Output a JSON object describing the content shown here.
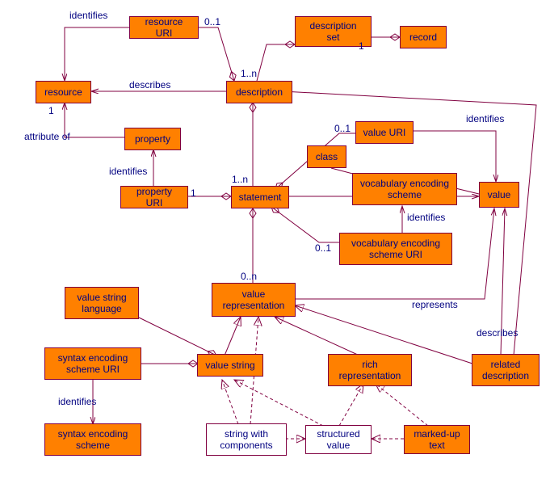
{
  "nodes": {
    "resource_uri": "resource URI",
    "description_set": "description set",
    "record": "record",
    "resource": "resource",
    "description": "description",
    "property": "property",
    "value_uri": "value URI",
    "property_uri": "property URI",
    "statement": "statement",
    "class": "class",
    "vocab_enc_scheme": "vocabulary encoding scheme",
    "value": "value",
    "vocab_enc_scheme_uri": "vocabulary encoding scheme URI",
    "value_string_lang": "value string language",
    "value_representation": "value representation",
    "syntax_enc_scheme_uri": "syntax encoding scheme URI",
    "value_string": "value string",
    "rich_representation": "rich representation",
    "related_description": "related description",
    "syntax_enc_scheme": "syntax encoding scheme",
    "string_with_components": "string with components",
    "structured_value": "structured value",
    "marked_up_text": "marked-up text"
  },
  "labels": {
    "identifies_1": "identifies",
    "c01_1": "0..1",
    "c1_recordset": "1",
    "describes": "describes",
    "c1n_desc": "1..n",
    "c1_resource": "1",
    "attribute_of": "attribute of",
    "identifies_prop": "identifies",
    "c1_propuri": "1",
    "c1n_stmt": "1..n",
    "c01_valueuri": "0..1",
    "identifies_value": "identifies",
    "identifies_ves": "identifies",
    "c01_ves": "0..1",
    "c0n_valrep": "0..n",
    "represents": "represents",
    "describes_rel": "describes",
    "identifies_ses": "identifies"
  },
  "chart_data": {
    "type": "diagram",
    "title": "DCMI Abstract Model (Description Set Model)",
    "entities": [
      {
        "id": "record",
        "name": "record",
        "kind": "class"
      },
      {
        "id": "description_set",
        "name": "description set",
        "kind": "class"
      },
      {
        "id": "description",
        "name": "description",
        "kind": "class"
      },
      {
        "id": "resource",
        "name": "resource",
        "kind": "class"
      },
      {
        "id": "resource_uri",
        "name": "resource URI",
        "kind": "class"
      },
      {
        "id": "property",
        "name": "property",
        "kind": "class"
      },
      {
        "id": "property_uri",
        "name": "property URI",
        "kind": "class"
      },
      {
        "id": "statement",
        "name": "statement",
        "kind": "class"
      },
      {
        "id": "class",
        "name": "class",
        "kind": "class"
      },
      {
        "id": "value",
        "name": "value",
        "kind": "class"
      },
      {
        "id": "value_uri",
        "name": "value URI",
        "kind": "class"
      },
      {
        "id": "vocab_enc_scheme",
        "name": "vocabulary encoding scheme",
        "kind": "class"
      },
      {
        "id": "vocab_enc_scheme_uri",
        "name": "vocabulary encoding scheme URI",
        "kind": "class"
      },
      {
        "id": "value_representation",
        "name": "value representation",
        "kind": "class"
      },
      {
        "id": "value_string",
        "name": "value string",
        "kind": "class"
      },
      {
        "id": "rich_representation",
        "name": "rich representation",
        "kind": "class"
      },
      {
        "id": "value_string_lang",
        "name": "value string language",
        "kind": "class"
      },
      {
        "id": "syntax_enc_scheme_uri",
        "name": "syntax encoding scheme URI",
        "kind": "class"
      },
      {
        "id": "syntax_enc_scheme",
        "name": "syntax encoding scheme",
        "kind": "class"
      },
      {
        "id": "related_description",
        "name": "related description",
        "kind": "class"
      },
      {
        "id": "string_with_components",
        "name": "string with components",
        "kind": "class-abstract"
      },
      {
        "id": "structured_value",
        "name": "structured value",
        "kind": "class-abstract"
      },
      {
        "id": "marked_up_text",
        "name": "marked-up text",
        "kind": "class"
      }
    ],
    "relationships": [
      {
        "from": "record",
        "to": "description_set",
        "type": "aggregation",
        "mult_to": "1"
      },
      {
        "from": "description_set",
        "to": "description",
        "type": "aggregation",
        "mult_to": "1..n"
      },
      {
        "from": "description",
        "to": "resource_uri",
        "type": "aggregation",
        "mult_to": "0..1"
      },
      {
        "from": "description",
        "to": "statement",
        "type": "aggregation",
        "mult_to": "1..n"
      },
      {
        "from": "description",
        "to": "resource",
        "type": "association",
        "label": "describes",
        "mult_to": "1"
      },
      {
        "from": "resource_uri",
        "to": "resource",
        "type": "association",
        "label": "identifies"
      },
      {
        "from": "property",
        "to": "resource",
        "type": "association",
        "label": "attribute of"
      },
      {
        "from": "property_uri",
        "to": "property",
        "type": "association",
        "label": "identifies"
      },
      {
        "from": "statement",
        "to": "property_uri",
        "type": "aggregation",
        "mult_to": "1"
      },
      {
        "from": "statement",
        "to": "value_uri",
        "type": "aggregation",
        "mult_to": "0..1"
      },
      {
        "from": "statement",
        "to": "vocab_enc_scheme_uri",
        "type": "aggregation",
        "mult_to": "0..1"
      },
      {
        "from": "statement",
        "to": "value_representation",
        "type": "aggregation",
        "mult_to": "0..n"
      },
      {
        "from": "statement",
        "to": "value",
        "type": "association"
      },
      {
        "from": "value_uri",
        "to": "value",
        "type": "association",
        "label": "identifies"
      },
      {
        "from": "vocab_enc_scheme_uri",
        "to": "vocab_enc_scheme",
        "type": "association",
        "label": "identifies"
      },
      {
        "from": "class",
        "to": "vocab_enc_scheme",
        "type": "association"
      },
      {
        "from": "vocab_enc_scheme",
        "to": "value",
        "type": "association"
      },
      {
        "from": "value_representation",
        "to": "value",
        "type": "association",
        "label": "represents"
      },
      {
        "from": "related_description",
        "to": "value",
        "type": "association",
        "label": "describes"
      },
      {
        "from": "value_string",
        "to": "value_representation",
        "type": "generalization"
      },
      {
        "from": "rich_representation",
        "to": "value_representation",
        "type": "generalization"
      },
      {
        "from": "related_description",
        "to": "value_representation",
        "type": "generalization"
      },
      {
        "from": "value_string",
        "to": "value_string_lang",
        "type": "aggregation"
      },
      {
        "from": "value_string",
        "to": "syntax_enc_scheme_uri",
        "type": "aggregation"
      },
      {
        "from": "syntax_enc_scheme_uri",
        "to": "syntax_enc_scheme",
        "type": "association",
        "label": "identifies"
      },
      {
        "from": "string_with_components",
        "to": "value_string",
        "type": "realization"
      },
      {
        "from": "structured_value",
        "to": "value_string",
        "type": "realization"
      },
      {
        "from": "structured_value",
        "to": "rich_representation",
        "type": "realization"
      },
      {
        "from": "string_with_components",
        "to": "structured_value",
        "type": "realization"
      },
      {
        "from": "marked_up_text",
        "to": "structured_value",
        "type": "realization"
      },
      {
        "from": "marked_up_text",
        "to": "rich_representation",
        "type": "realization"
      }
    ]
  }
}
